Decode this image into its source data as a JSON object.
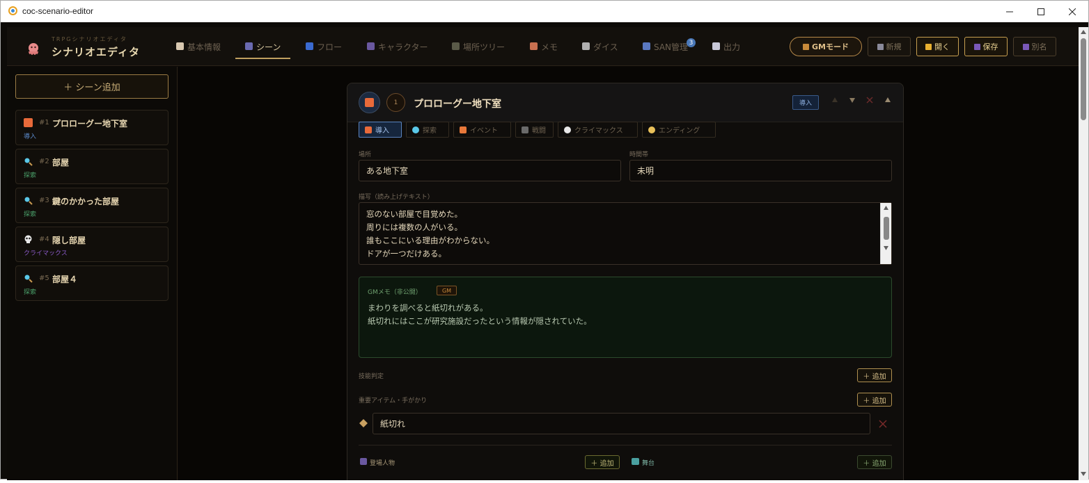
{
  "window": {
    "title": "coc-scenario-editor"
  },
  "header": {
    "subtitle": "TRPGシナリオエディタ",
    "title": "シナリオエディタ",
    "tabs": [
      {
        "label": "基本情報",
        "icon": "document-icon",
        "color": "#d8c8b0"
      },
      {
        "label": "シーン",
        "icon": "clapper-icon",
        "color": "#6a6ab0"
      },
      {
        "label": "フロー",
        "icon": "shuffle-icon",
        "color": "#3a6ad0"
      },
      {
        "label": "キャラクター",
        "icon": "people-icon",
        "color": "#6a58a0"
      },
      {
        "label": "場所ツリー",
        "icon": "map-icon",
        "color": "#5a5a48"
      },
      {
        "label": "メモ",
        "icon": "memo-icon",
        "color": "#c87050"
      },
      {
        "label": "ダイス",
        "icon": "dice-icon",
        "color": "#b0b0b0"
      },
      {
        "label": "SAN管理",
        "icon": "chart-icon",
        "color": "#5a78c0"
      },
      {
        "label": "出力",
        "icon": "page-icon",
        "color": "#c8c8d8"
      }
    ],
    "san_badge": "3",
    "buttons": {
      "gm": "GMモード",
      "new": "新規",
      "open": "開く",
      "save": "保存",
      "save_as": "別名"
    }
  },
  "sidebar": {
    "add_scene": "＋ シーン追加",
    "scenes": [
      {
        "num": "#1",
        "name": "プロローグー地下室",
        "type": "導入",
        "type_color": "#5a88c8",
        "icon": "sunrise-icon"
      },
      {
        "num": "#2",
        "name": "部屋",
        "type": "探索",
        "type_color": "#4aa06a",
        "icon": "magnifier-icon"
      },
      {
        "num": "#3",
        "name": "鍵のかかった部屋",
        "type": "探索",
        "type_color": "#4aa06a",
        "icon": "magnifier-icon"
      },
      {
        "num": "#4",
        "name": "隠し部屋",
        "type": "クライマックス",
        "type_color": "#8a5ac8",
        "icon": "skull-icon"
      },
      {
        "num": "#5",
        "name": "部屋４",
        "type": "探索",
        "type_color": "#4aa06a",
        "icon": "magnifier-icon"
      }
    ]
  },
  "scene": {
    "number": "1",
    "title": "プロローグー地下室",
    "type_tag": "導入",
    "types": [
      "導入",
      "探索",
      "イベント",
      "戦闘",
      "クライマックス",
      "エンディング"
    ],
    "location_label": "場所",
    "location": "ある地下室",
    "time_label": "時間帯",
    "time": "未明",
    "desc_label": "描写（読み上げテキスト）",
    "desc_lines": [
      "窓のない部屋で目覚めた。",
      "周りには複数の人がいる。",
      "誰もここにいる理由がわからない。",
      "ドアが一つだけある。"
    ],
    "gm_label": "GMメモ（非公開）",
    "gm_tag": "GM",
    "gm_lines": [
      "まわりを調べると紙切れがある。",
      "紙切れにはここが研究施設だったという情報が隠されていた。"
    ],
    "skill_label": "技能判定",
    "item_label": "重要アイテム・手がかり",
    "add": "＋ 追加",
    "item_value": "紙切れ",
    "characters_label": "登場人物",
    "stage_label": "舞台"
  }
}
